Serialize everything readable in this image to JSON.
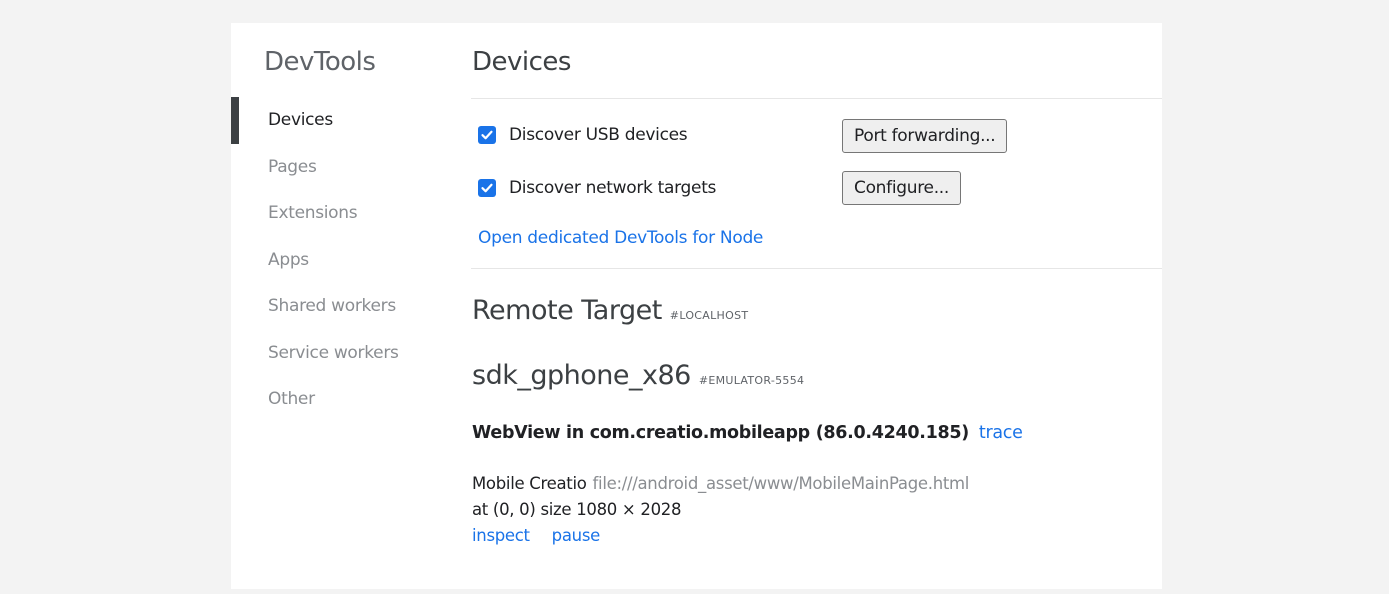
{
  "sidebar": {
    "title": "DevTools",
    "items": [
      {
        "label": "Devices",
        "active": true
      },
      {
        "label": "Pages",
        "active": false
      },
      {
        "label": "Extensions",
        "active": false
      },
      {
        "label": "Apps",
        "active": false
      },
      {
        "label": "Shared workers",
        "active": false
      },
      {
        "label": "Service workers",
        "active": false
      },
      {
        "label": "Other",
        "active": false
      }
    ]
  },
  "main": {
    "title": "Devices",
    "usb": {
      "label": "Discover USB devices",
      "checked": true,
      "button": "Port forwarding..."
    },
    "network": {
      "label": "Discover network targets",
      "checked": true,
      "button": "Configure..."
    },
    "node_link": "Open dedicated DevTools for Node",
    "remote_target": {
      "title": "Remote Target",
      "tag": "#LOCALHOST"
    },
    "device": {
      "name": "sdk_gphone_x86",
      "tag": "#EMULATOR-5554"
    },
    "webview": {
      "title": "WebView in com.creatio.mobileapp (86.0.4240.185)",
      "trace_link": "trace"
    },
    "target": {
      "name": "Mobile Creatio",
      "url": "file:///android_asset/www/MobileMainPage.html",
      "position_text": "at (0, 0)",
      "size_text": "size 1080 × 2028",
      "inspect_link": "inspect",
      "pause_link": "pause"
    }
  },
  "colors": {
    "accent": "#1a73e8",
    "active_bar": "#3c4043",
    "inactive_text": "#8a8d91"
  }
}
